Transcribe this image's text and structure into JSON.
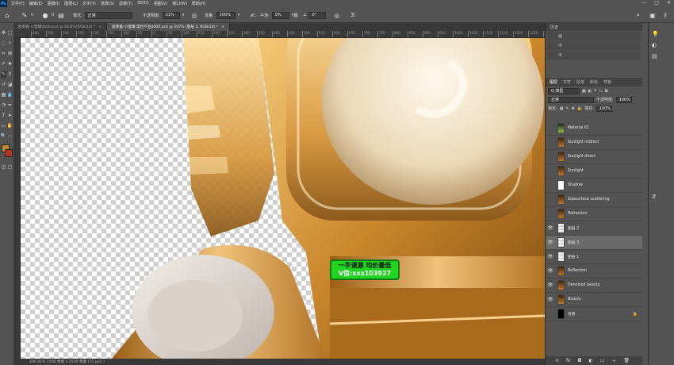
{
  "app": {
    "logo": "Ps"
  },
  "menubar": {
    "items": [
      "文件(F)",
      "编辑(E)",
      "图像(I)",
      "图层(L)",
      "文字(Y)",
      "选择(S)",
      "滤镜(T)",
      "3D(D)",
      "视图(V)",
      "窗口(W)",
      "帮助(H)"
    ],
    "win_controls": [
      "—",
      "□",
      "✕"
    ]
  },
  "options": {
    "mode_label": "模式:",
    "mode_value": "正常",
    "opacity_label": "不透明度:",
    "opacity_value": "21%",
    "flow_label": "流量:",
    "flow_value": "100%",
    "smooth_label": "平滑:",
    "smooth_value": "0%",
    "angle_value": "0°",
    "brush_size": "0"
  },
  "tabs": [
    {
      "label": "欧莱雅-小蜜罐0000.psd @ 44.6%(RGB/16) *",
      "close": "×",
      "active": false
    },
    {
      "label": "欧莱雅-小蜜罐-渠世产品0000.psd @ 207% (图层 3, RGB/16) *",
      "close": "×",
      "active": true
    }
  ],
  "ruler": [
    "400",
    "350",
    "300",
    "250",
    "200",
    "150",
    "100",
    "50",
    "0",
    "50",
    "100",
    "150",
    "200",
    "250",
    "300",
    "350",
    "400",
    "450",
    "500",
    "550",
    "600",
    "650",
    "700",
    "750",
    "800",
    "850",
    "900",
    "950",
    "1000",
    "1050",
    "1100",
    "1150",
    "1200",
    "1250",
    "1300"
  ],
  "watermark": {
    "line1": "一手课源 均价最低",
    "line2": "V信:xxx103927"
  },
  "status": {
    "text": "206.81%   1500 像素 x 2500 像素 (72 ppi)  〉"
  },
  "history": {
    "title": "历史",
    "items": [
      "画",
      "中",
      "中"
    ]
  },
  "layers_panel": {
    "tabs": [
      "图层",
      "字符",
      "段落",
      "颜色",
      "样板"
    ],
    "kind_value": "Q 类型",
    "blend_value": "正常",
    "opacity_label": "不透明度:",
    "opacity_value": "100%",
    "lock_label": "锁定:",
    "fill_label": "填充:",
    "fill_value": "100%",
    "layers": [
      {
        "name": "Material ID",
        "visible": false,
        "thumb": "green",
        "selected": false
      },
      {
        "name": "Sunlight indirect",
        "visible": false,
        "thumb": "gold",
        "selected": false
      },
      {
        "name": "Sunlight direct",
        "visible": false,
        "thumb": "gold",
        "selected": false
      },
      {
        "name": "Sunlight",
        "visible": false,
        "thumb": "gold",
        "selected": false
      },
      {
        "name": "Shadow",
        "visible": false,
        "thumb": "white",
        "selected": false
      },
      {
        "name": "Subsurface scattering",
        "visible": false,
        "thumb": "gold",
        "selected": false
      },
      {
        "name": "Refraction",
        "visible": false,
        "thumb": "gold",
        "selected": false
      },
      {
        "name": "图层 2",
        "visible": true,
        "thumb": "chk",
        "selected": false
      },
      {
        "name": "图层 3",
        "visible": true,
        "thumb": "chk",
        "selected": true
      },
      {
        "name": "图层 1",
        "visible": true,
        "thumb": "chk",
        "selected": false
      },
      {
        "name": "Reflection",
        "visible": true,
        "thumb": "gold",
        "selected": false
      },
      {
        "name": "Denoised beauty",
        "visible": true,
        "thumb": "gold",
        "selected": false
      },
      {
        "name": "Beauty",
        "visible": true,
        "thumb": "gold",
        "selected": false
      },
      {
        "name": "背景",
        "visible": false,
        "thumb": "black",
        "selected": false,
        "locked": true
      }
    ],
    "footer": [
      "∞",
      "fx",
      "◘",
      "◐",
      "▭",
      "＋",
      "🗑"
    ]
  }
}
